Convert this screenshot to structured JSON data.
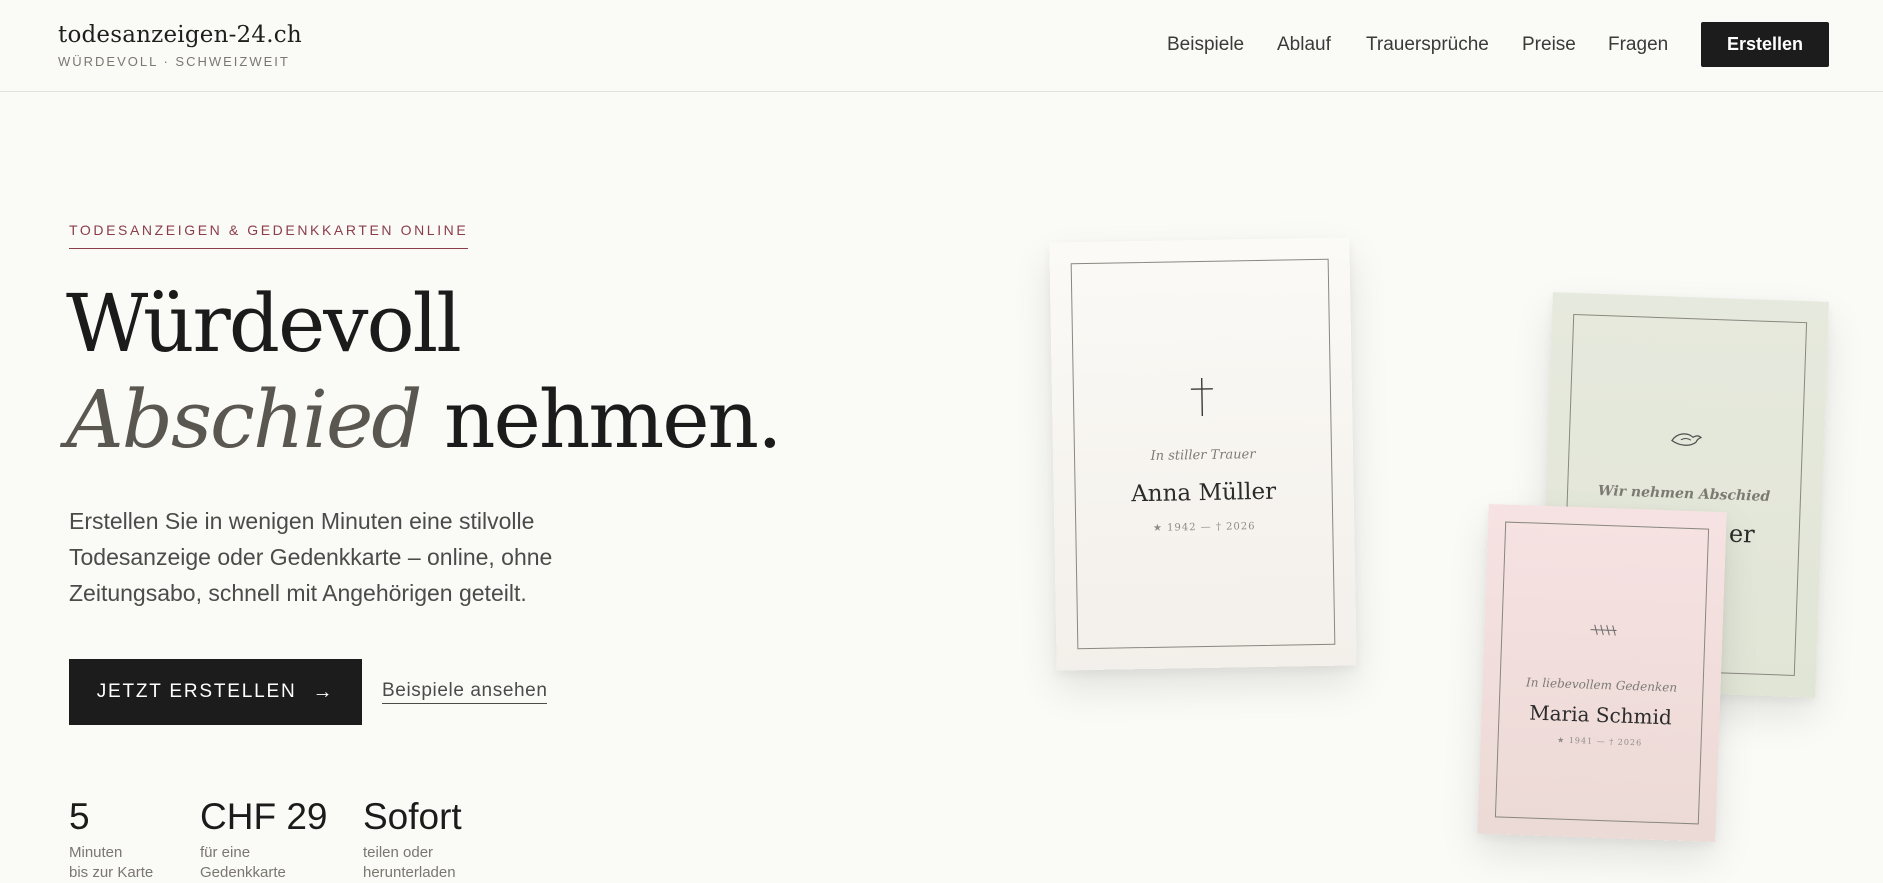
{
  "brand": {
    "name": "todesanzeigen-24.ch",
    "tagline": "WÜRDEVOLL · SCHWEIZWEIT"
  },
  "nav": {
    "items": [
      "Beispiele",
      "Ablauf",
      "Trauersprüche",
      "Preise",
      "Fragen"
    ],
    "cta_label": "Erstellen"
  },
  "hero": {
    "eyebrow": "TODESANZEIGEN & GEDENKKARTEN ONLINE",
    "title_line1": "Würdevoll",
    "title_accent": "Abschied",
    "title_rest": "nehmen.",
    "description": "Erstellen Sie in wenigen Minuten eine stilvolle Todesanzeige oder Gedenkkarte – online, ohne Zeitungsabo, schnell mit Angehörigen geteilt.",
    "primary_cta": "JETZT ERSTELLEN",
    "secondary_cta": "Beispiele ansehen"
  },
  "stats": [
    {
      "value": "5",
      "label_line1": "Minuten",
      "label_line2": "bis zur Karte"
    },
    {
      "value": "CHF 29",
      "label_line1": "für eine",
      "label_line2": "Gedenkkarte"
    },
    {
      "value": "Sofort",
      "label_line1": "teilen oder",
      "label_line2": "herunterladen"
    }
  ],
  "cards": [
    {
      "symbol": "cross-icon",
      "subtitle": "In stiller Trauer",
      "name": "Anna Müller",
      "dates": "★ 1942 — † 2026",
      "background": "#f7f4ef"
    },
    {
      "symbol": "dove-icon",
      "subtitle": "Wir nehmen Abschied",
      "name_visible_fragment": "er",
      "background": "#e4e8db"
    },
    {
      "symbol": "birds-icon",
      "subtitle": "In liebevollem Gedenken",
      "name": "Maria Schmid",
      "dates": "★ 1941 — † 2026",
      "background": "#f2dfdd"
    }
  ],
  "colors": {
    "background": "#fafaf6",
    "dark_button": "#1c1c1c",
    "accent": "#8b3d4a"
  }
}
